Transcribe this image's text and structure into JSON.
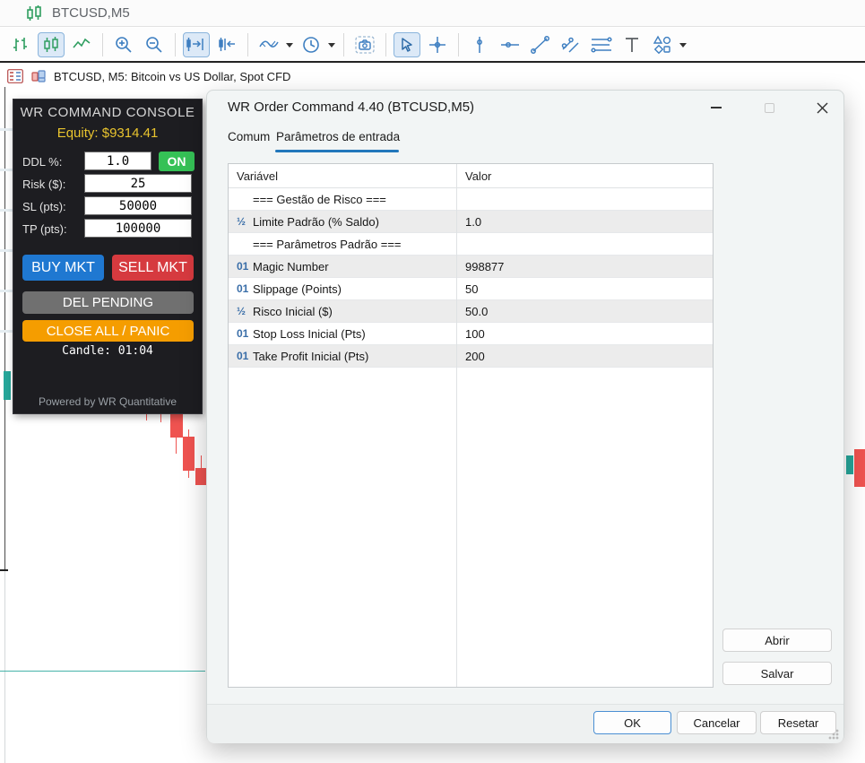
{
  "window": {
    "title": "BTCUSD,M5",
    "info_bar_text": "BTCUSD, M5:  Bitcoin vs US Dollar, Spot CFD"
  },
  "toolbar": {
    "icons": [
      "ohlc-bars",
      "candlesticks",
      "line-chart",
      "zoom-in",
      "zoom-out",
      "scroll-to-chart-end",
      "chart-shift",
      "indicators",
      "timeframes",
      "screenshot",
      "cursor",
      "crosshair",
      "vertical-line",
      "horizontal-line",
      "trendline",
      "channel",
      "equidistant-lines",
      "text-tool",
      "shapes"
    ],
    "selected": [
      "candlesticks",
      "scroll-to-chart-end",
      "cursor"
    ]
  },
  "console": {
    "title": "WR COMMAND CONSOLE",
    "equity": "Equity: $9314.41",
    "fields": [
      {
        "label": "DDL %:",
        "value": "1.0"
      },
      {
        "label": "Risk ($):",
        "value": "25"
      },
      {
        "label": "SL (pts):",
        "value": "50000"
      },
      {
        "label": "TP (pts):",
        "value": "100000"
      }
    ],
    "on_button": "ON",
    "buy_button": "BUY MKT",
    "sell_button": "SELL MKT",
    "del_pending_button": "DEL PENDING",
    "close_all_button": "CLOSE ALL / PANIC",
    "candle_timer": "Candle: 01:04",
    "footer": "Powered by WR Quantitative",
    "colors": {
      "equity": "#e9c42e",
      "on": "#35c156",
      "buy": "#1f78d1",
      "sell": "#d63a3f",
      "del": "#707070",
      "panic": "#f59d00",
      "background": "#1d1d21"
    }
  },
  "dialog": {
    "title": "WR Order Command 4.40 (BTCUSD,M5)",
    "tabs": [
      {
        "label": "Comum",
        "active": false
      },
      {
        "label": "Parâmetros de entrada",
        "active": true
      }
    ],
    "table": {
      "columns": [
        "Variável",
        "Valor"
      ],
      "rows": [
        {
          "icon": "",
          "label": "=== Gestão de Risco ===",
          "value": ""
        },
        {
          "icon": "½",
          "label": "Limite Padrão (% Saldo)",
          "value": "1.0"
        },
        {
          "icon": "",
          "label": "=== Parâmetros Padrão ===",
          "value": ""
        },
        {
          "icon": "01",
          "label": "Magic Number",
          "value": "998877"
        },
        {
          "icon": "01",
          "label": "Slippage (Points)",
          "value": "50"
        },
        {
          "icon": "½",
          "label": "Risco Inicial ($)",
          "value": "50.0"
        },
        {
          "icon": "01",
          "label": "Stop Loss Inicial (Pts)",
          "value": "100"
        },
        {
          "icon": "01",
          "label": "Take Profit Inicial (Pts)",
          "value": "200"
        }
      ]
    },
    "buttons": {
      "abrir": "Abrir",
      "salvar": "Salvar",
      "ok": "OK",
      "cancelar": "Cancelar",
      "resetar": "Resetar"
    },
    "accent": "#2277bb"
  },
  "chart": {
    "candle_up_color": "#26a69a",
    "candle_down_color": "#ef5350"
  }
}
